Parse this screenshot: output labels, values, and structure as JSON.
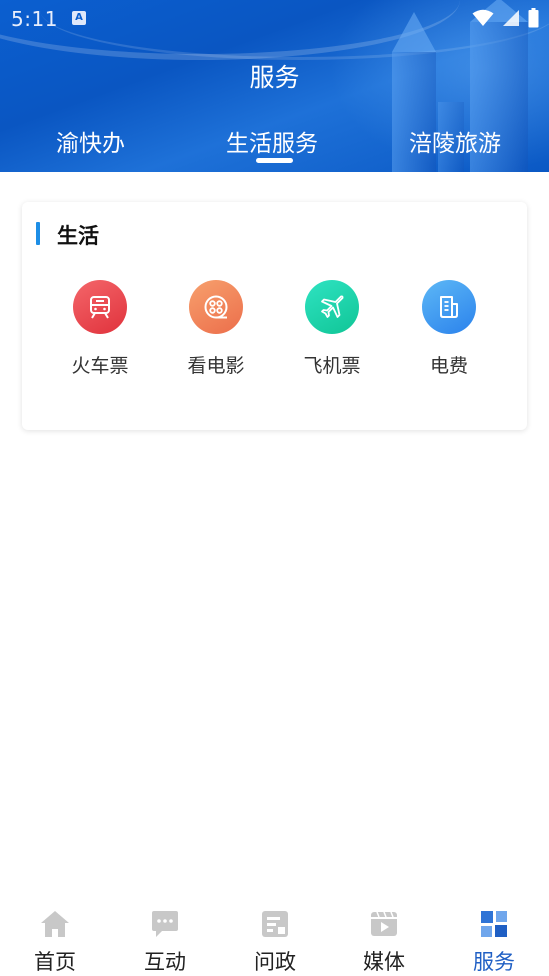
{
  "status_bar": {
    "time": "5:11",
    "app_badge": "A"
  },
  "header": {
    "title": "服务",
    "tabs": [
      {
        "label": "渝快办"
      },
      {
        "label": "生活服务",
        "active": true
      },
      {
        "label": "涪陵旅游"
      }
    ]
  },
  "section": {
    "title": "生活",
    "items": [
      {
        "label": "火车票",
        "icon": "train-icon",
        "color": "#e8404a"
      },
      {
        "label": "看电影",
        "icon": "film-reel-icon",
        "color": "#f0855a"
      },
      {
        "label": "飞机票",
        "icon": "airplane-icon",
        "color": "#17cfa3"
      },
      {
        "label": "电费",
        "icon": "bill-document-icon",
        "color": "#3a92ee"
      }
    ]
  },
  "bottom_nav": {
    "items": [
      {
        "label": "首页",
        "icon": "home-icon"
      },
      {
        "label": "互动",
        "icon": "chat-icon"
      },
      {
        "label": "问政",
        "icon": "form-icon"
      },
      {
        "label": "媒体",
        "icon": "video-icon"
      },
      {
        "label": "服务",
        "icon": "grid-icon",
        "active": true
      }
    ],
    "active_color": "#1f5fc4",
    "inactive_icon_color": "#c8c8c8"
  }
}
